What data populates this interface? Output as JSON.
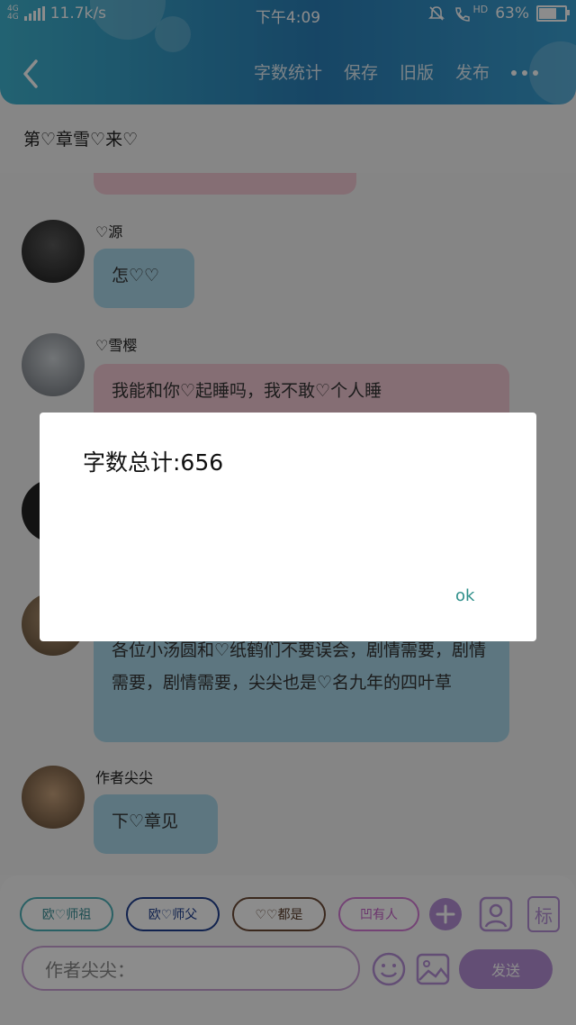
{
  "status_bar": {
    "network_tag_top": "4G",
    "network_tag_bottom": "4G",
    "speed": "11.7k/s",
    "time": "下午4:09",
    "hd": "HD",
    "battery": "63%",
    "battery_level": 0.63
  },
  "toolbar": {
    "word_count": "字数统计",
    "save": "保存",
    "old_version": "旧版",
    "publish": "发布"
  },
  "chapter": {
    "title": "第♡章雪♡来♡"
  },
  "chat": {
    "messages": [
      {
        "name": "♡源",
        "text": "怎♡♡"
      },
      {
        "name": "♡雪樱",
        "text": "我能和你♡起睡吗，我不敢♡个人睡"
      },
      {
        "text": "各位小汤圆和♡纸鹤们不要误会，剧情需要，剧情需要，剧情需要，尖尖也是♡名九年的四叶草"
      },
      {
        "name": "作者尖尖",
        "text": "下♡章见"
      }
    ]
  },
  "chips": [
    "欧♡师祖",
    "欧♡师父",
    "♡♡都是",
    "凹有人"
  ],
  "input": {
    "placeholder": "作者尖尖："
  },
  "send_label": "发送",
  "tag_label": "标",
  "dialog": {
    "text": "字数总计:656",
    "ok": "ok"
  }
}
